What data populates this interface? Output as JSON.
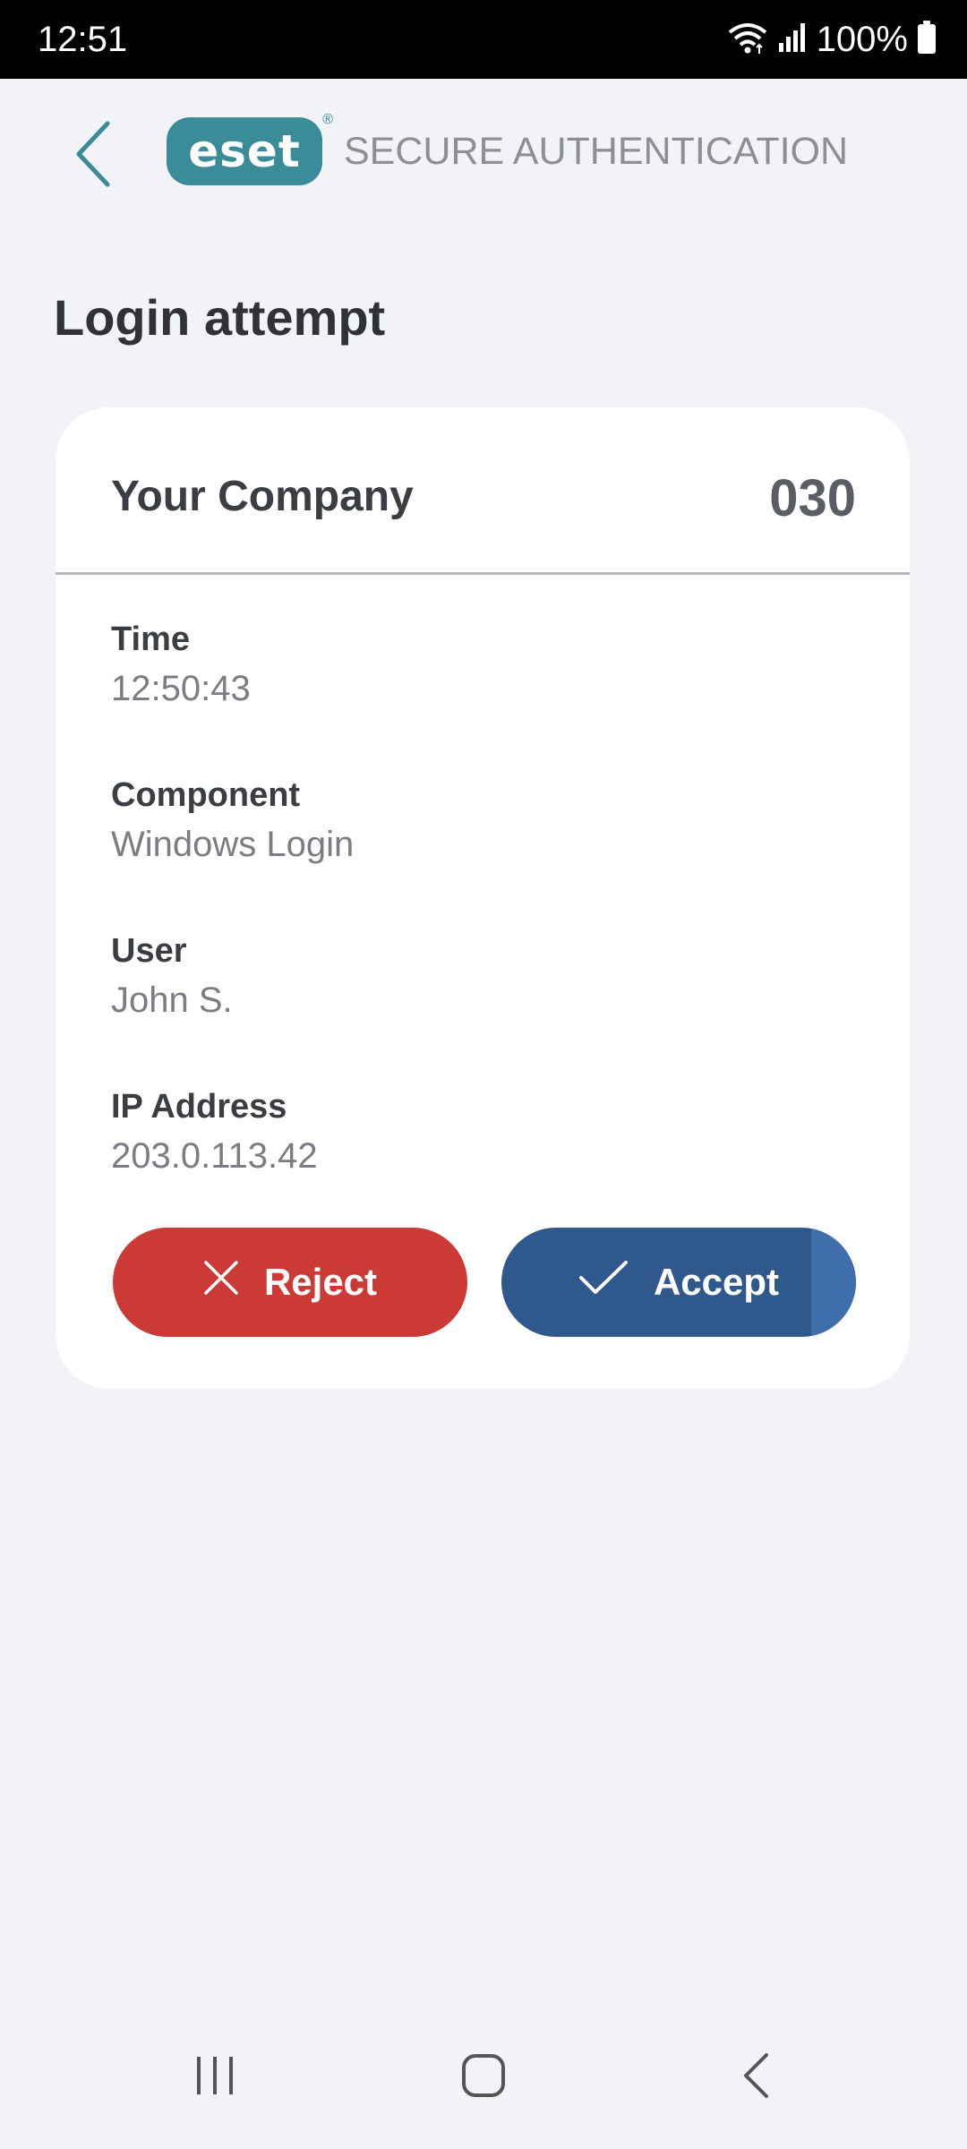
{
  "status_bar": {
    "time": "12:51",
    "battery": "100%",
    "icons": [
      "wifi-icon",
      "signal-icon",
      "battery-icon"
    ]
  },
  "header": {
    "back_icon": "chevron-left-icon",
    "logo_text": "eset",
    "logo_reg": "®",
    "app_title": "SECURE AUTHENTICATION"
  },
  "page": {
    "title": "Login attempt"
  },
  "card": {
    "company": "Your Company",
    "code": "030",
    "fields": [
      {
        "label": "Time",
        "value": "12:50:43"
      },
      {
        "label": "Component",
        "value": "Windows Login"
      },
      {
        "label": "User",
        "value": "John S."
      },
      {
        "label": "IP Address",
        "value": "203.0.113.42"
      }
    ],
    "reject_label": "Reject",
    "accept_label": "Accept"
  },
  "navbar": {
    "icons": [
      "recents-icon",
      "home-icon",
      "back-icon"
    ]
  },
  "colors": {
    "accent": "#3a8c98",
    "reject": "#cc3a36",
    "accept": "#2f588c",
    "background": "#f2f3f6"
  }
}
